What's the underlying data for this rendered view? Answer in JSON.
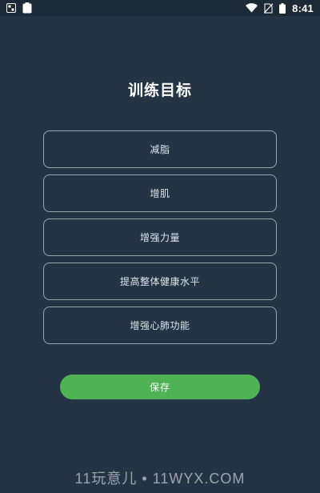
{
  "status_bar": {
    "time": "8:41",
    "icons": [
      "gallery-icon",
      "clipboard-icon",
      "wifi-icon",
      "no-sim-icon",
      "battery-icon"
    ]
  },
  "page": {
    "title": "训练目标"
  },
  "goals": [
    {
      "label": "减脂"
    },
    {
      "label": "增肌"
    },
    {
      "label": "增强力量"
    },
    {
      "label": "提高整体健康水平"
    },
    {
      "label": "增强心肺功能"
    }
  ],
  "actions": {
    "save_label": "保存"
  },
  "watermark": {
    "text": "11玩意儿 • 11WYX.COM"
  },
  "colors": {
    "background": "#243444",
    "status_bar": "#1c2a37",
    "option_border": "#9aa6b2",
    "accent_green": "#4fb355"
  }
}
